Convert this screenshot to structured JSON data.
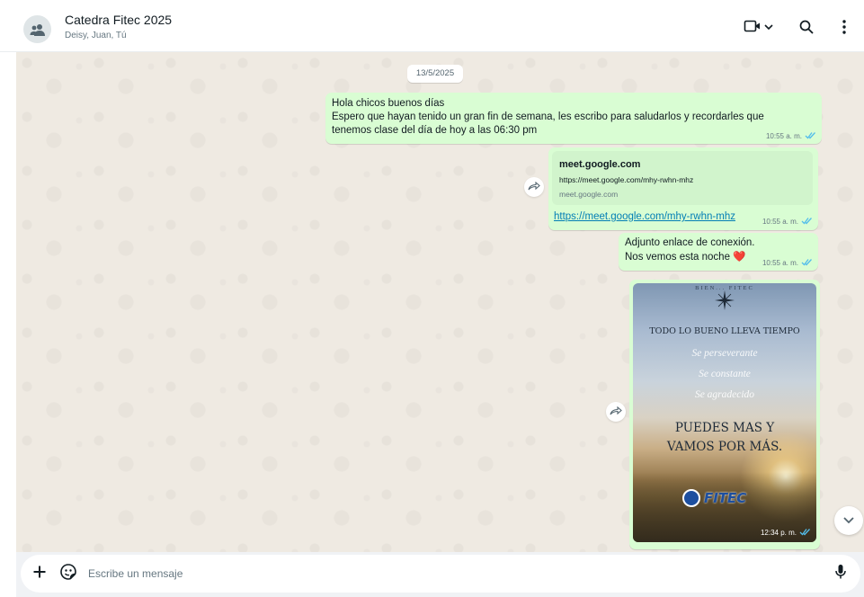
{
  "header": {
    "title": "Catedra Fitec 2025",
    "participants": "Deisy, Juan, Tú",
    "icons": [
      "group-avatar-icon",
      "video-call-icon",
      "chevron-down-icon",
      "search-icon",
      "more-options-icon"
    ]
  },
  "chat": {
    "date_chip": "13/5/2025",
    "messages": [
      {
        "lines": [
          "Hola chicos buenos días",
          "Espero que hayan tenido un gran fin de semana, les escribo para saludarlos y recordarles que",
          "tenemos clase del día de hoy a las 06:30 pm"
        ],
        "time": "10:55 a. m."
      },
      {
        "preview": {
          "title": "meet.google.com",
          "description": "https://meet.google.com/mhy-rwhn-mhz",
          "domain": "meet.google.com"
        },
        "link": "https://meet.google.com/mhy-rwhn-mhz",
        "time": "10:55 a. m."
      },
      {
        "lines": [
          "Adjunto enlace de conexión.",
          "Nos vemos esta noche ❤️"
        ],
        "time": "10:55 a. m."
      },
      {
        "image": {
          "arc_text": "BIEN... FITEC",
          "headline": "TODO LO BUENO LLEVA TIEMPO",
          "script_lines": [
            "Se perseverante",
            "Se constante",
            "Se agradecido"
          ],
          "big_lines": [
            "PUEDES MAS Y",
            "VAMOS POR MÁS."
          ],
          "logo_text": "FITEC"
        },
        "time": "12:34 p. m."
      }
    ]
  },
  "composer": {
    "placeholder": "Escribe un mensaje",
    "value": ""
  },
  "colors": {
    "bubble_out": "#d9fdd3",
    "read_ticks": "#53bdeb",
    "chat_bg": "#efeae2",
    "link": "#027eb5"
  }
}
